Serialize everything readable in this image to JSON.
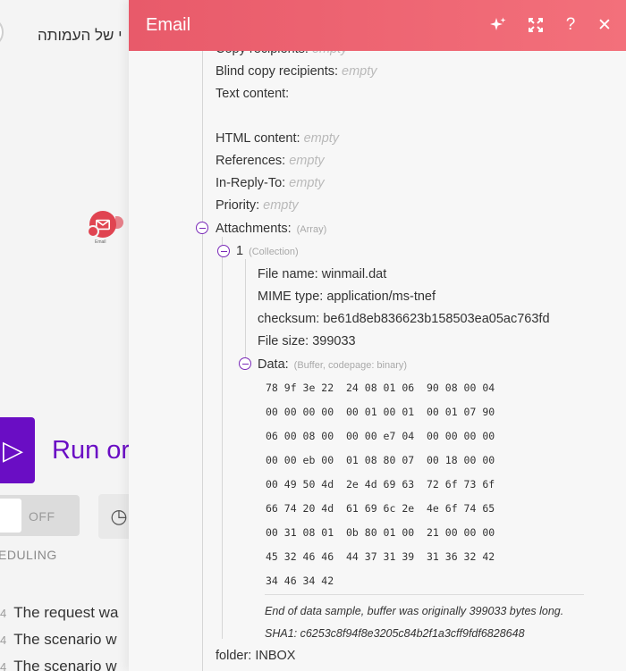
{
  "background": {
    "scenario_title": "י של העמותה",
    "module_label": "Email",
    "run_button_label": "Run or",
    "toggle_label": "OFF",
    "scheduling_label": "EDULING",
    "log_lines": [
      {
        "num": "4",
        "text": "The request wa"
      },
      {
        "num": "4",
        "text": "The scenario w"
      },
      {
        "num": "4",
        "text": "The scenario w"
      }
    ]
  },
  "panel": {
    "title": "Email",
    "icons": [
      "sparkle-icon",
      "expand-icon",
      "help-icon",
      "close-icon"
    ],
    "help_glyph": "?",
    "close_glyph": "✕",
    "fields": {
      "copy_recipients": {
        "key": "Copy recipients:",
        "value": "empty"
      },
      "blind_copy_recipients": {
        "key": "Blind copy recipients:",
        "value": "empty"
      },
      "text_content": {
        "key": "Text content:",
        "value": ""
      },
      "html_content": {
        "key": "HTML content:",
        "value": "empty"
      },
      "references": {
        "key": "References:",
        "value": "empty"
      },
      "in_reply_to": {
        "key": "In-Reply-To:",
        "value": "empty"
      },
      "priority": {
        "key": "Priority:",
        "value": "empty"
      },
      "attachments": {
        "key": "Attachments:",
        "type": "(Array)"
      },
      "item_1": {
        "key": "1",
        "type": "(Collection)"
      },
      "file_name": {
        "key": "File name:",
        "value": "winmail.dat"
      },
      "mime_type": {
        "key": "MIME type:",
        "value": "application/ms-tnef"
      },
      "checksum": {
        "key": "checksum:",
        "value": "be61d8eb836623b158503ea05ac763fd"
      },
      "file_size": {
        "key": "File size:",
        "value": "399033"
      },
      "data": {
        "key": "Data:",
        "type": "(Buffer, codepage: binary)"
      },
      "folder": {
        "key": "folder:",
        "value": "INBOX"
      }
    },
    "hex_dump": [
      "78 9f 3e 22  24 08 01 06  90 08 00 04",
      "00 00 00 00  00 01 00 01  00 01 07 90",
      "06 00 08 00  00 00 e7 04  00 00 00 00",
      "00 00 eb 00  01 08 80 07  00 18 00 00",
      "00 49 50 4d  2e 4d 69 63  72 6f 73 6f",
      "66 74 20 4d  61 69 6c 2e  4e 6f 74 65",
      "00 31 08 01  0b 80 01 00  21 00 00 00",
      "45 32 46 46  44 37 31 39  31 36 32 42",
      "34 46 34 42"
    ],
    "data_note": "End of data sample, buffer was originally 399033 bytes long.",
    "sha1_note": "SHA1: c6253c8f94f8e3205c84b2f1a3cff9fdf6828648"
  },
  "colors": {
    "header_start": "#e85a6a",
    "header_end": "#f3707b",
    "accent_purple": "#6a0dc4",
    "module_red": "#e04451"
  }
}
